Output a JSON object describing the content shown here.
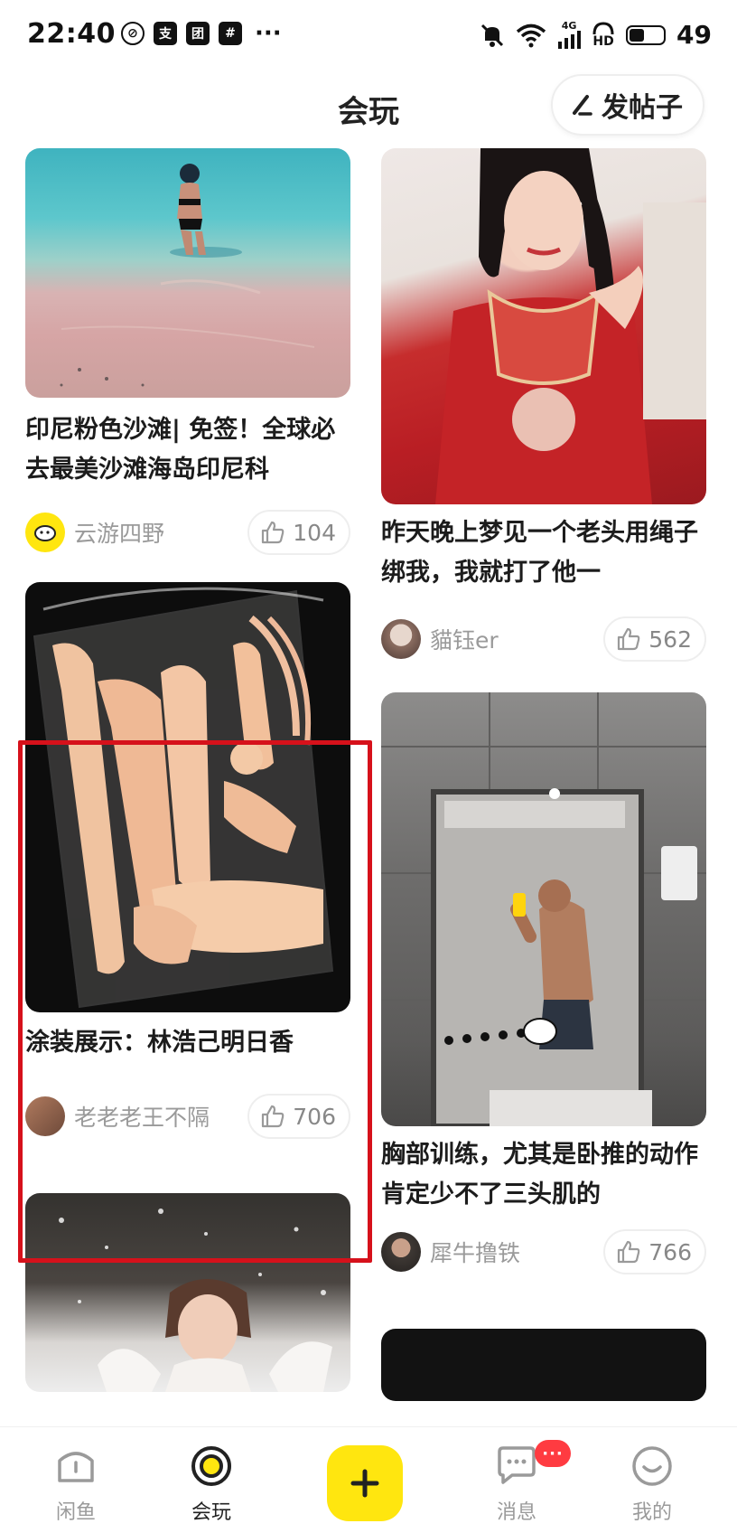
{
  "status_bar": {
    "time": "22:40",
    "left_icons": [
      "do-not-disturb-icon",
      "alipay-icon",
      "meituan-icon",
      "app-icon"
    ],
    "more": "···",
    "network": "4G",
    "hd": "HD",
    "battery_level": "49",
    "battery_fraction": 0.49
  },
  "header": {
    "title": "会玩",
    "post_button_label": "发帖子"
  },
  "feed": {
    "left": [
      {
        "title": "印尼粉色沙滩| 免签！全球必去最美沙滩海岛印尼科",
        "author": "云游四野",
        "likes": "104",
        "image": "pink-beach-photo"
      },
      {
        "title": "涂装展示：林浩己明日香",
        "author": "老老老王不隔",
        "likes": "706",
        "image": "figure-parts-bag-photo"
      },
      {
        "image": "snow-portrait-photo"
      }
    ],
    "right": [
      {
        "title": "昨天晚上梦见一个老头用绳子绑我，我就打了他一",
        "author": "貓钰er",
        "likes": "562",
        "image": "red-hanfu-portrait-photo"
      },
      {
        "title": "胸部训练，尤其是卧推的动作肯定少不了三头肌的",
        "author": "犀牛撸铁",
        "likes": "766",
        "image": "gym-mirror-selfie-photo"
      },
      {
        "image": "dark-photo"
      }
    ]
  },
  "bottom_nav": {
    "items": [
      {
        "label": "闲鱼",
        "icon": "home-icon"
      },
      {
        "label": "会玩",
        "icon": "target-icon",
        "active": true
      },
      {
        "label": "",
        "icon": "plus-icon"
      },
      {
        "label": "消息",
        "icon": "chat-icon",
        "badge": "···"
      },
      {
        "label": "我的",
        "icon": "smile-icon"
      }
    ]
  },
  "colors": {
    "accent_yellow": "#ffe60f",
    "highlight_red": "#d6111b",
    "badge_red": "#ff3b41"
  }
}
